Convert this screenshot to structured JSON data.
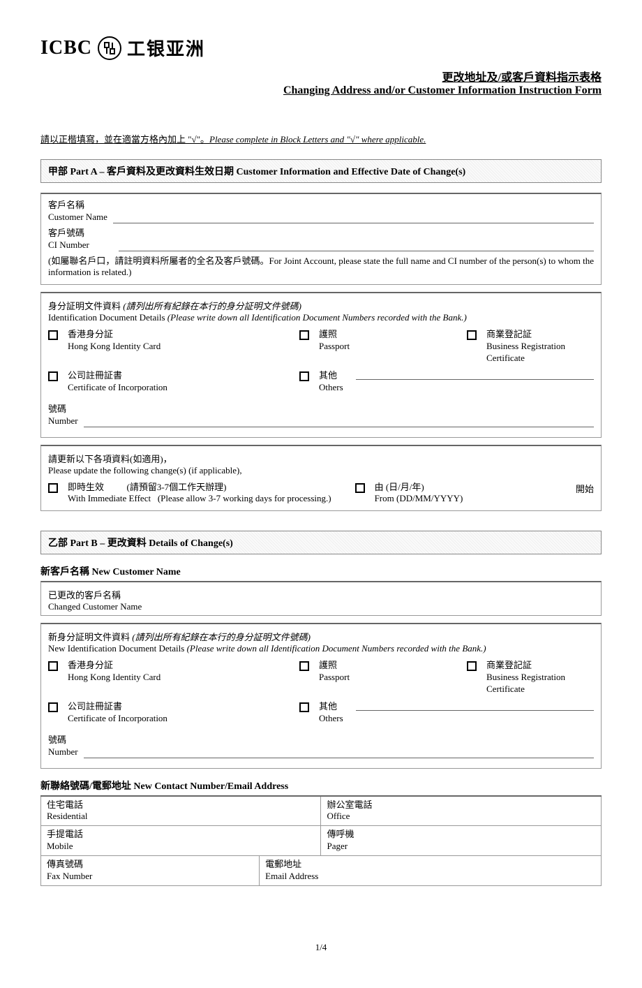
{
  "logo": {
    "brand": "ICBC",
    "symbol": "㊔",
    "brand_cn": "工银亚洲"
  },
  "title": {
    "cn": "更改地址及/或客戶資料指示表格",
    "en": "Changing Address and/or Customer Information Instruction Form"
  },
  "instruction": {
    "cn_prefix": "請以正楷填寫，並在適當方格內加上 \"√\"。",
    "en": "Please complete in Block Letters and \"√\" where applicable."
  },
  "partA": {
    "header": "甲部   Part A –  客戶資料及更改資料生效日期  Customer Information and Effective Date of Change(s)",
    "customer_name_cn": "客戶名稱",
    "customer_name_en": "Customer Name",
    "ci_number_cn": "客戶號碼",
    "ci_number_en": "CI Number",
    "joint_note": "(如屬聯名戶口，請註明資料所屬者的全名及客戶號碼。For Joint Account, please state the full name and CI number of the person(s) to whom the information is related.)",
    "id_heading_cn": "身分証明文件資料",
    "id_heading_note_cn": "(請列出所有紀錄在本行的身分証明文件號碼)",
    "id_heading_en": "Identification Document Details",
    "id_heading_note_en": "(Please write down all Identification Document Numbers recorded with the Bank.)",
    "hkid_cn": "香港身分証",
    "hkid_en": "Hong Kong Identity Card",
    "passport_cn": "護照",
    "passport_en": "Passport",
    "brc_cn": "商業登記証",
    "brc_en": "Business Registration Certificate",
    "coi_cn": "公司註冊証書",
    "coi_en": "Certificate of Incorporation",
    "others_cn": "其他",
    "others_en": "Others",
    "number_cn": "號碼",
    "number_en": "Number",
    "update_line_cn": "請更新以下各項資料(如適用)，",
    "update_line_en": "Please update the following change(s) (if applicable),",
    "immediate_cn": "即時生效",
    "immediate_note_cn": "(請預留3-7個工作天辦理)",
    "immediate_en": "With Immediate Effect",
    "immediate_note_en": "(Please allow 3-7 working days for processing.)",
    "from_cn": "由   (日/月/年)",
    "from_en": "From (DD/MM/YYYY)",
    "start_cn": "開始"
  },
  "partB": {
    "header": "乙部   Part B –  更改資料  Details of Change(s)",
    "new_name_heading": "新客戶名稱  New Customer Name",
    "changed_name_cn": "已更改的客戶名稱",
    "changed_name_en": "Changed Customer Name",
    "new_id_heading_cn": "新身分証明文件資料",
    "new_id_heading_note_cn": "(請列出所有紀錄在本行的身分証明文件號碼)",
    "new_id_heading_en": "New Identification Document Details",
    "new_id_heading_note_en": "(Please write down all Identification Document Numbers recorded with the Bank.)",
    "contact_heading": "新聯絡號碼/電郵地址  New Contact Number/Email Address",
    "residential_cn": "住宅電話",
    "residential_en": "Residential",
    "office_cn": "辦公室電話",
    "office_en": "Office",
    "mobile_cn": "手提電話",
    "mobile_en": "Mobile",
    "pager_cn": "傳呼機",
    "pager_en": "Pager",
    "fax_cn": "傳真號碼",
    "fax_en": "Fax Number",
    "email_cn": "電郵地址",
    "email_en": "Email Address"
  },
  "page_num": "1/4"
}
